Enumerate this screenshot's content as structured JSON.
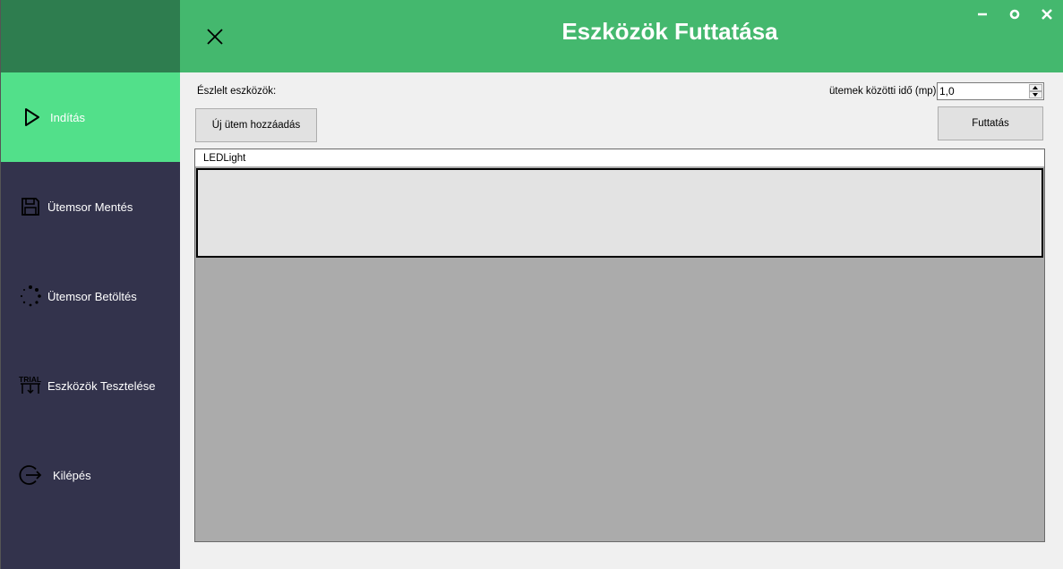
{
  "header": {
    "title": "Eszközök Futtatása"
  },
  "sidebar": {
    "items": [
      {
        "label": "Indítás",
        "icon": "play-icon"
      },
      {
        "label": "Ütemsor Mentés",
        "icon": "save-icon"
      },
      {
        "label": "Ütemsor Betöltés",
        "icon": "loading-icon"
      },
      {
        "label": "Eszközök Tesztelése",
        "icon": "trial-icon"
      },
      {
        "label": "Kilépés",
        "icon": "logout-icon"
      }
    ]
  },
  "content": {
    "detected_label": "Észlelt eszközök:",
    "add_step_button": "Új ütem hozzáadás",
    "interval_label": "ütemek közötti idő (mp)",
    "interval_value": "1,0",
    "run_button": "Futtatás",
    "devices": [
      {
        "name": "LEDLight"
      }
    ]
  },
  "colors": {
    "header": "#44b86e",
    "sidebar": "#33334c",
    "sidebar_logo": "#2e7d4f",
    "active_item": "#52e08a"
  }
}
